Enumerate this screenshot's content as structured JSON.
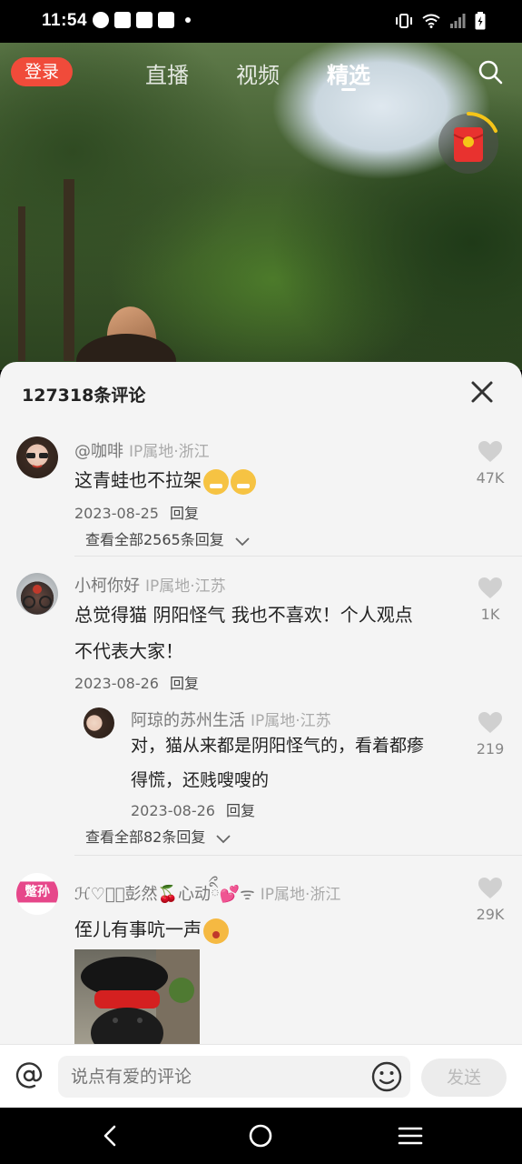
{
  "status_bar": {
    "time": "11:54"
  },
  "top_nav": {
    "login": "登录",
    "tabs": [
      {
        "label": "直播"
      },
      {
        "label": "视频"
      },
      {
        "label": "精选",
        "active": true
      }
    ]
  },
  "comments_sheet": {
    "title": "127318条评论",
    "comments": [
      {
        "user": "@咖啡",
        "ip": "IP属地·浙江",
        "text": "这青蛙也不拉架",
        "date": "2023-08-25",
        "reply": "回复",
        "likes": "47K",
        "more": "查看全部2565条回复"
      },
      {
        "user": "小柯你好",
        "ip": "IP属地·江苏",
        "text_line1": "总觉得猫  阴阳怪气  我也不喜欢！个人观点",
        "text_line2": "不代表大家！",
        "date": "2023-08-26",
        "reply": "回复",
        "likes": "1K",
        "sub_reply": {
          "user": "阿琼的苏州生活",
          "ip": "IP属地·江苏",
          "text_line1": "对，猫从来都是阴阳怪气的，看着都瘆",
          "text_line2": "得慌，还贱嗖嗖的",
          "date": "2023-08-26",
          "reply": "回复",
          "likes": "219"
        },
        "more": "查看全部82条回复"
      },
      {
        "user": "ℋ♡ིྀ彭然🍒心动ིྀ💕ᯤ",
        "ip": "IP属地·浙江",
        "text": "侄儿有事吭一声",
        "likes": "29K",
        "avatar_text": "蹩孙"
      }
    ]
  },
  "input_bar": {
    "placeholder": "说点有爱的评论",
    "send": "发送"
  },
  "colors": {
    "accent_red": "#f04b3a",
    "sheet_bg": "#f4f4f4"
  }
}
